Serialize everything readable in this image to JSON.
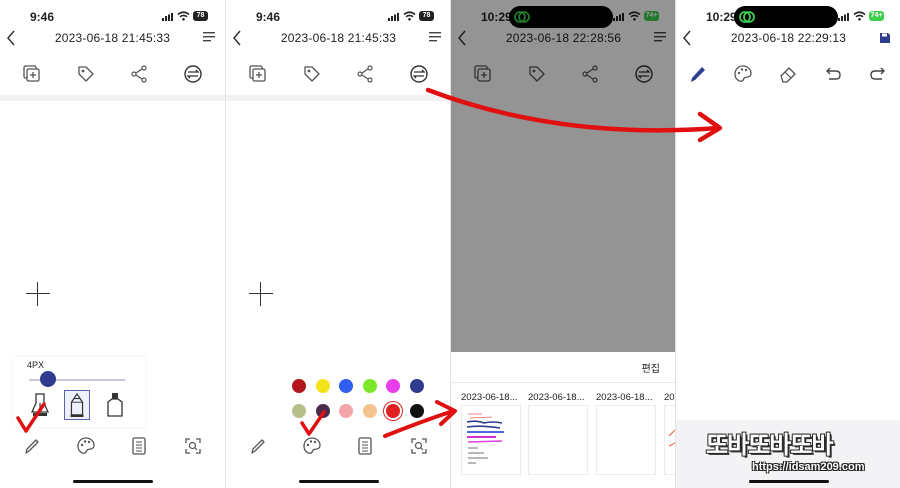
{
  "panels": [
    {
      "status": {
        "time": "9:46",
        "battery": "78"
      },
      "nav": {
        "title": "2023-06-18 21:45:33"
      },
      "size_popup": {
        "label": "4PX",
        "slider_value_fraction": 0.2
      },
      "toolbar_icons": [
        "add-page-icon",
        "tag-icon",
        "share-icon",
        "settings-icon"
      ],
      "bottom_icons": [
        "pencil-icon",
        "palette-icon",
        "pages-icon",
        "zoom-icon"
      ]
    },
    {
      "status": {
        "time": "9:46",
        "battery": "78"
      },
      "nav": {
        "title": "2023-06-18 21:45:33"
      },
      "palette": [
        "#b0161b",
        "#f2e31b",
        "#2f5ef0",
        "#7ce72a",
        "#e93ee9",
        "#2e3b8f",
        "#b6bf8a",
        "#4a2b4e",
        "#f3a6a8",
        "#f5c48e",
        "#e02020",
        "#111111"
      ],
      "palette_selected": 10
    },
    {
      "status": {
        "time": "10:29",
        "battery": "74+"
      },
      "nav": {
        "title": "2023-06-18 22:28:56"
      },
      "sheet": {
        "edit_label": "편집",
        "thumb_titles": [
          "2023-06-18...",
          "2023-06-18...",
          "2023-06-18...",
          "20"
        ]
      }
    },
    {
      "status": {
        "time": "10:29",
        "battery": "74+"
      },
      "nav": {
        "title": "2023-06-18 22:29:13"
      },
      "toolbar_icons": [
        "pen-icon",
        "palette-icon",
        "eraser-icon",
        "undo-icon",
        "redo-icon"
      ],
      "accent_color": "#2e3b8f"
    }
  ],
  "watermark": {
    "line1": "또바또바또바",
    "line2": "https://idsam209.com"
  },
  "annotation_color": "#e01010"
}
